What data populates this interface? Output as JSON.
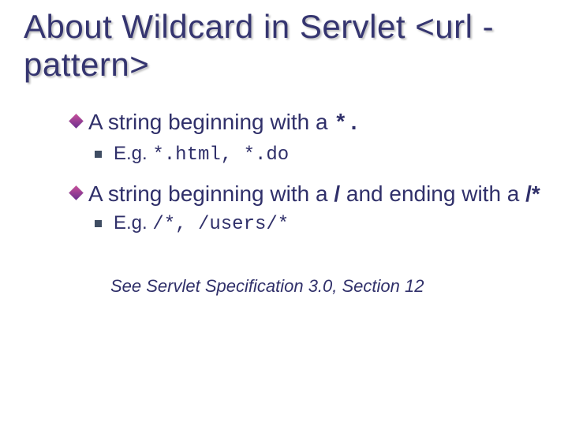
{
  "title": "About Wildcard in Servlet <url -pattern>",
  "bullets": [
    {
      "text_pre": "A string beginning with a ",
      "code": "*.",
      "sub": {
        "label": "E.g. ",
        "code": "*.html, *.do"
      }
    },
    {
      "text_pre": "A string beginning with a ",
      "code1": "/",
      "text_mid": " and ending with a ",
      "code2": "/*",
      "sub": {
        "label": "E.g. ",
        "code": "/*, /users/*"
      }
    }
  ],
  "reference": "See Servlet Specification 3.0, Section 12"
}
